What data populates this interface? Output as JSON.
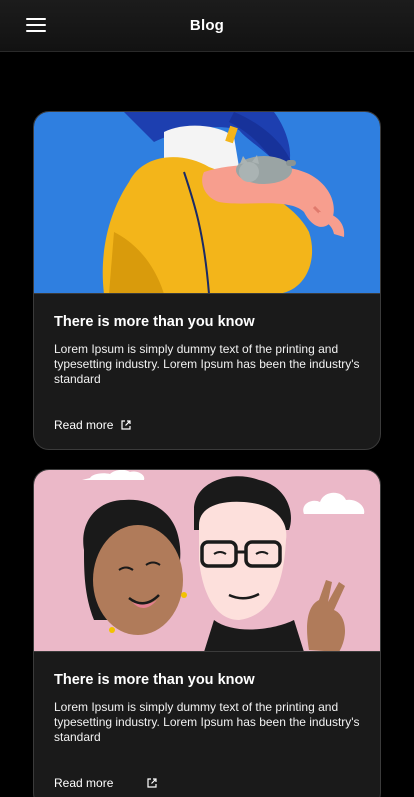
{
  "header": {
    "title": "Blog"
  },
  "posts": [
    {
      "title": "There is more than you know",
      "excerpt": "Lorem Ipsum is simply dummy text of the printing and typesetting industry. Lorem Ipsum has been the industry's standard",
      "link_label": "Read more",
      "link_icon": "external-link-icon",
      "image_bg": "#2f7fe0"
    },
    {
      "title": "There is more than you know",
      "excerpt": "Lorem Ipsum is simply dummy text of the printing and typesetting industry. Lorem Ipsum has been the industry's standard",
      "link_label": "Read more",
      "link_icon": "external-link-icon",
      "image_bg": "#ebb8c8"
    }
  ]
}
